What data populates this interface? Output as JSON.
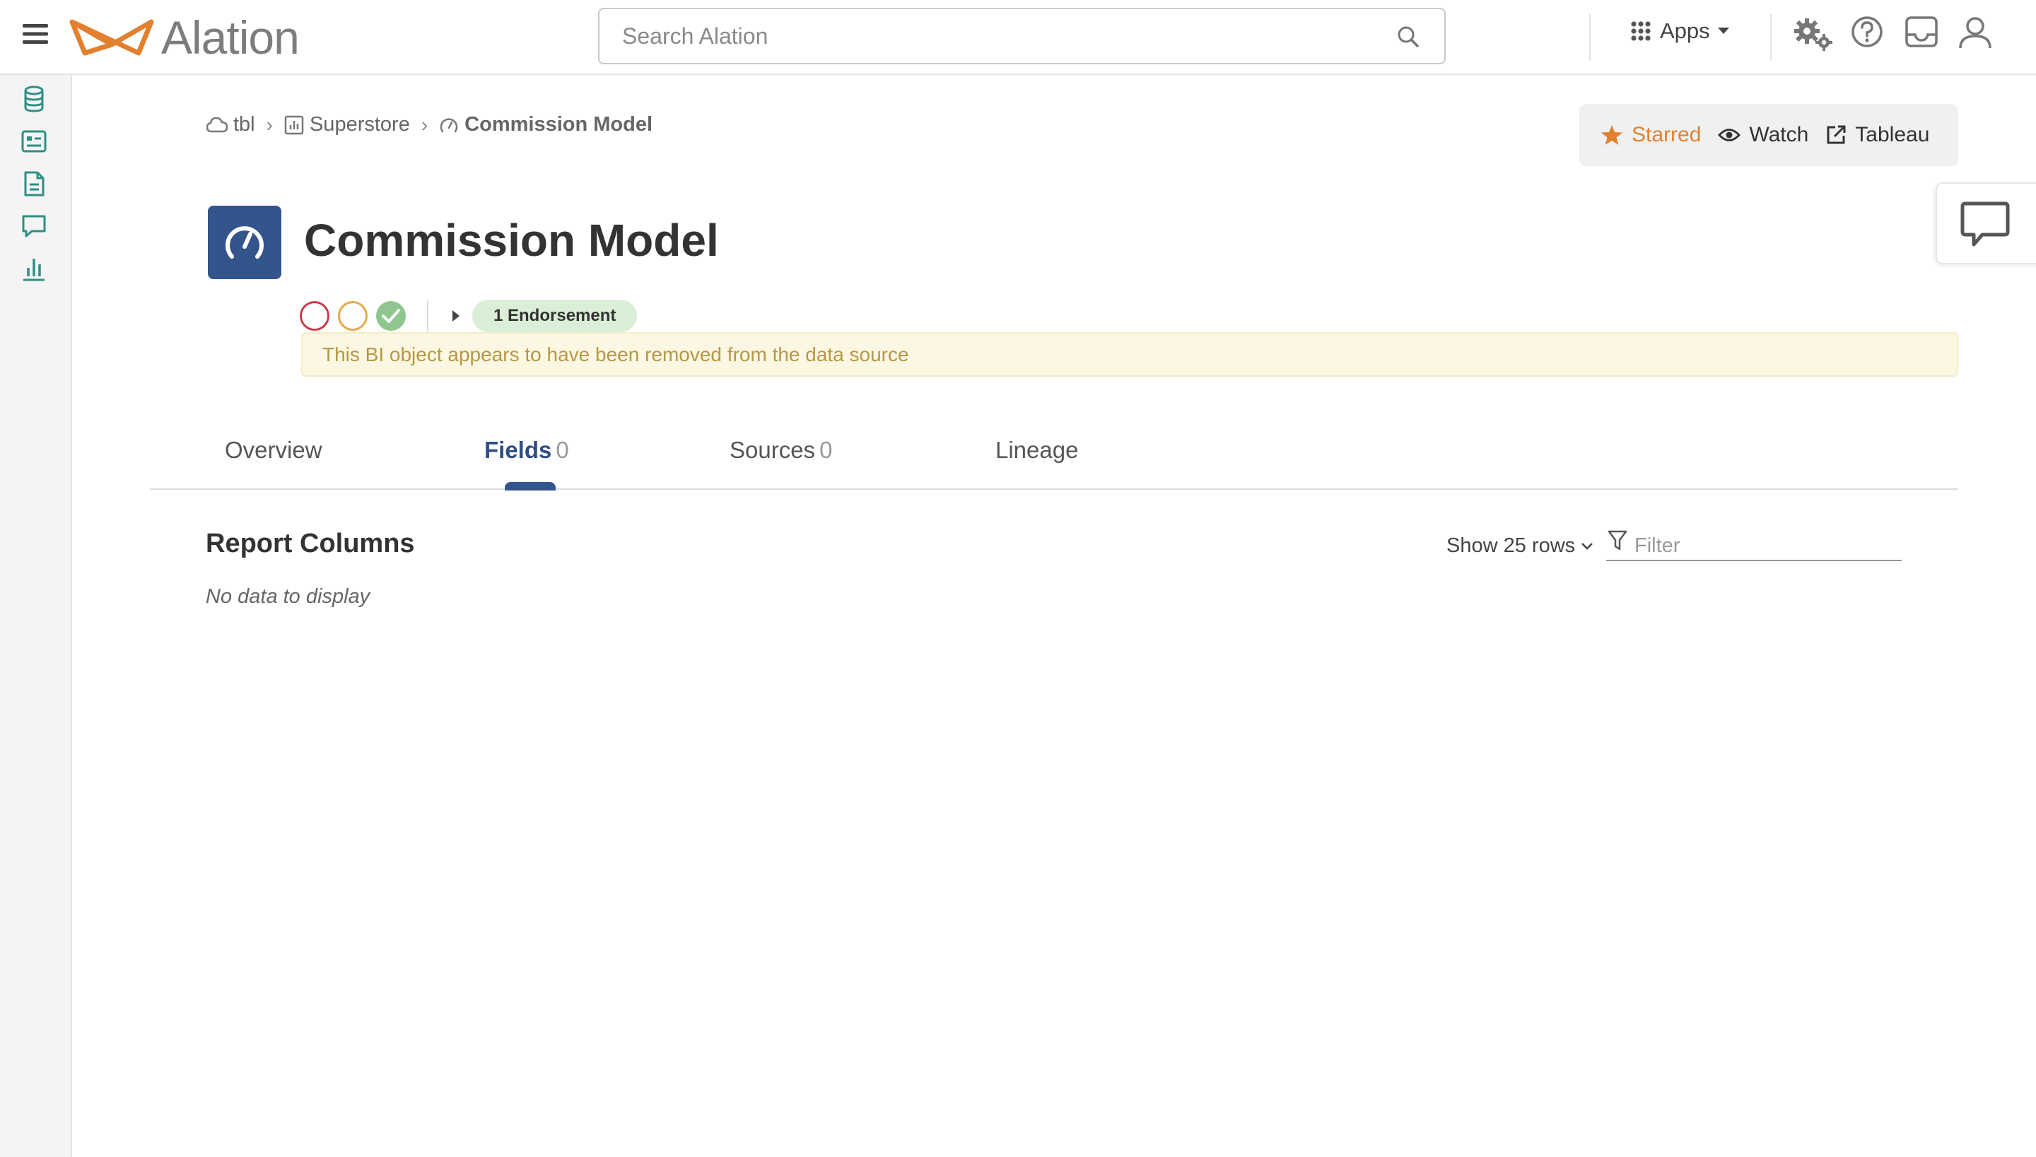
{
  "header": {
    "logo_text": "Alation",
    "search_placeholder": "Search Alation",
    "apps_label": "Apps"
  },
  "breadcrumb": {
    "items": [
      {
        "label": "tbl",
        "icon": "cloud-icon"
      },
      {
        "label": "Superstore",
        "icon": "workbook-icon"
      },
      {
        "label": "Commission Model",
        "icon": "dashboard-gauge-icon"
      }
    ]
  },
  "actions": {
    "starred_label": "Starred",
    "watch_label": "Watch",
    "tableau_label": "Tableau"
  },
  "object": {
    "title": "Commission Model",
    "endorsement_label": "1 Endorsement",
    "alert_text": "This BI object appears to have been removed from the data source"
  },
  "tabs": [
    {
      "label": "Overview",
      "count": ""
    },
    {
      "label": "Fields",
      "count": "0"
    },
    {
      "label": "Sources",
      "count": "0"
    },
    {
      "label": "Lineage",
      "count": ""
    }
  ],
  "content": {
    "section_title": "Report Columns",
    "empty_text": "No data to display",
    "rows_label": "Show 25 rows",
    "filter_placeholder": "Filter"
  },
  "colors": {
    "brand_orange": "#e3802f",
    "primary_blue": "#34558b",
    "rail_icon": "#2e8f85",
    "deprecate_red": "#cf3a48",
    "warning_yellow": "#e3a94a",
    "endorse_green": "#8fc58f",
    "alert_bg": "#fcf7e3"
  }
}
